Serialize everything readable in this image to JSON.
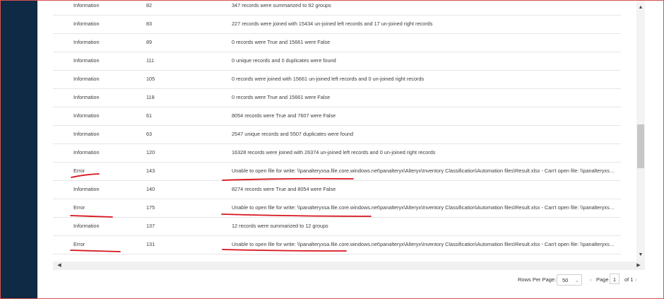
{
  "log": {
    "rows": [
      {
        "type": "Information",
        "tool": "82",
        "message": "347 records were summarized to 92 groups"
      },
      {
        "type": "Information",
        "tool": "83",
        "message": "227 records were joined with 15434 un-joined left records and 17 un-joined right records"
      },
      {
        "type": "Information",
        "tool": "89",
        "message": "0 records were True and 15661 were False"
      },
      {
        "type": "Information",
        "tool": "111",
        "message": "0 unique records and 0 duplicates were found"
      },
      {
        "type": "Information",
        "tool": "105",
        "message": "0 records were joined with 15661 un-joined left records and 0 un-joined right records"
      },
      {
        "type": "Information",
        "tool": "118",
        "message": "0 records were True and 15661 were False"
      },
      {
        "type": "Information",
        "tool": "61",
        "message": "8054 records were True and 7607 were False"
      },
      {
        "type": "Information",
        "tool": "63",
        "message": "2547 unique records and 5507 duplicates were found"
      },
      {
        "type": "Information",
        "tool": "120",
        "message": "16328 records were joined with 26374 un-joined left records and 0 un-joined right records"
      },
      {
        "type": "Error",
        "tool": "143",
        "message": "Unable to open file for write: \\\\panalteryxsa.file.core.windows.net\\panalteryx\\Alteryx\\Inventory Classification\\Automation files\\Result.xlsx - Can't open file: \\\\panalteryxsa.file...."
      },
      {
        "type": "Information",
        "tool": "140",
        "message": "8274 records were True and 8054 were False"
      },
      {
        "type": "Error",
        "tool": "175",
        "message": "Unable to open file for write: \\\\panalteryxsa.file.core.windows.net\\panalteryx\\Alteryx\\Inventory Classification\\Automation files\\Result.xlsx - Can't open file: \\\\panalteryxsa.file...."
      },
      {
        "type": "Information",
        "tool": "137",
        "message": "12 records were summarized to 12 groups"
      },
      {
        "type": "Error",
        "tool": "131",
        "message": "Unable to open file for write: \\\\panalteryxsa.file.core.windows.net\\panalteryx\\Alteryx\\Inventory Classification\\Automation files\\Result.xlsx - Can't open file: \\\\panalteryxsa.file...."
      }
    ]
  },
  "pagination": {
    "rows_per_page_label": "Rows Per Page:",
    "rows_per_page_value": "50",
    "page_label": "Page",
    "page_value": "1",
    "of_label": "of 1",
    "prev_icon": "‹",
    "next_icon": "›"
  },
  "colors": {
    "sidebar": "#0e2a44",
    "annotation": "#d8141e",
    "frame": "#d9534f"
  }
}
